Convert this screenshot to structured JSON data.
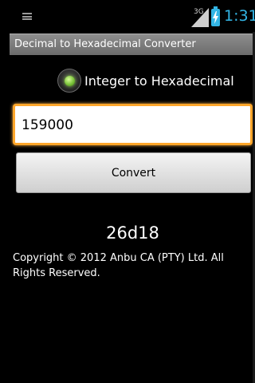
{
  "status_bar": {
    "network": "3G",
    "time": "1:31",
    "accent_color": "#33b5e5"
  },
  "app": {
    "title": "Decimal to Hexadecimal Converter"
  },
  "mode": {
    "label": "Integer to Hexadecimal",
    "selected": true
  },
  "input": {
    "value": "159000"
  },
  "convert_button": {
    "label": "Convert"
  },
  "result": {
    "value": "26d18"
  },
  "footer": {
    "copyright": "Copyright © 2012 Anbu CA (PTY) Ltd. All Rights Reserved."
  },
  "colors": {
    "input_border": "#ffa62a",
    "radio_on": "#7ac23a",
    "title_bar": "#7a7a7a"
  },
  "icons": {
    "menu": "menu-icon",
    "signal": "signal-icon",
    "battery": "battery-charging-icon",
    "radio": "radio-button-icon"
  }
}
